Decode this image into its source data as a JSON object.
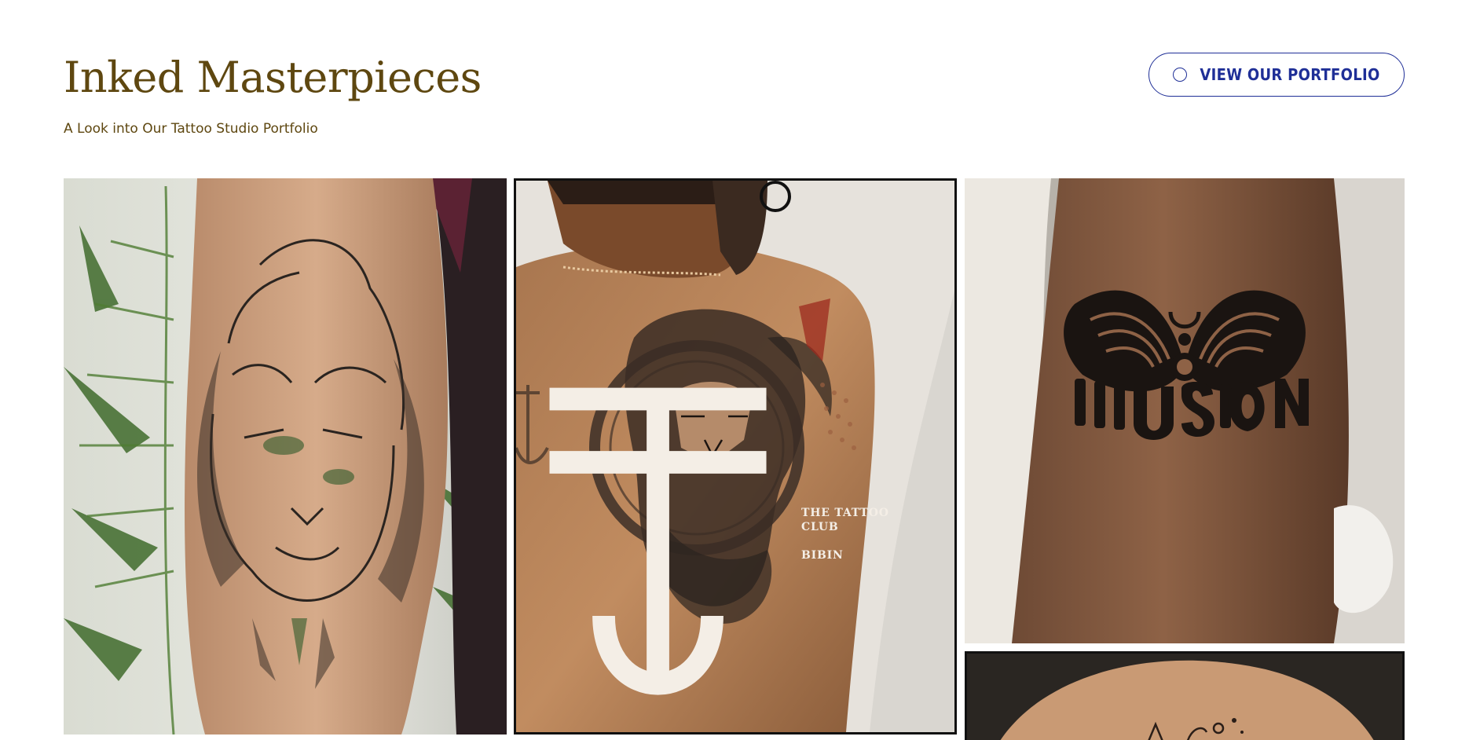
{
  "header": {
    "title": "Inked Masterpieces",
    "subtitle": "A Look into Our Tattoo Studio Portfolio",
    "portfolio_button": {
      "label": "VIEW OUR PORTFOLIO",
      "icon": "circle-icon"
    }
  },
  "gallery": {
    "images": [
      {
        "subject": "lion-forearm-tattoo"
      },
      {
        "subject": "zeus-back-tattoo",
        "watermark": {
          "line1": "THE TATTOO CLUB",
          "line2": "BIBIN"
        }
      },
      {
        "subject": "illusion-butterfly-tattoo"
      },
      {
        "subject": "shoulder-tattoo"
      }
    ]
  },
  "colors": {
    "title": "#5e4710",
    "accent": "#1f2f97",
    "background": "#ffffff"
  }
}
